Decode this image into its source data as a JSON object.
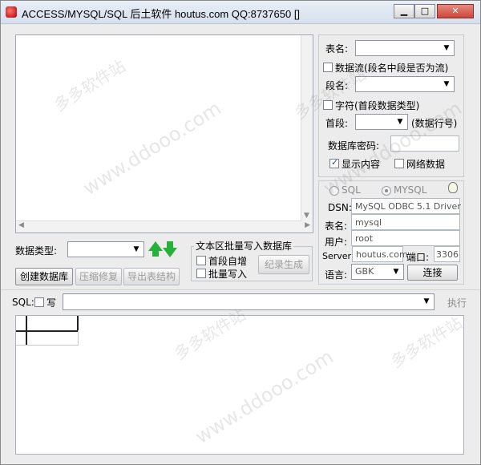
{
  "window": {
    "title": "ACCESS/MYSQL/SQL 后土软件 houtus.com QQ:8737650 []",
    "minimize_glyph": "▁",
    "maximize_glyph": "□",
    "close_glyph": "✕"
  },
  "right_panel": {
    "table_name_label": "表名:",
    "data_stream_label": "数据流(段名中段是否为流)",
    "field_name_label": "段名:",
    "char_label": "字符(首段数据类型)",
    "first_field_label": "首段:",
    "data_row_label": "(数据行号)",
    "db_password_label": "数据库密码:",
    "show_content_label": "显示内容",
    "network_data_label": "网络数据",
    "show_content_checked": true,
    "network_data_checked": false
  },
  "connection": {
    "sql_radio_label": "SQL",
    "mysql_radio_label": "MYSQL",
    "selected": "MYSQL",
    "dsn_label": "DSN:",
    "dsn_value": "MySQL ODBC 5.1 Driver",
    "table_label": "表名:",
    "table_value": "mysql",
    "user_label": "用户:",
    "user_value": "root",
    "server_label": "Server:",
    "server_value": "houtus.com",
    "port_label": "端口:",
    "port_value": "3306",
    "language_label": "语言:",
    "language_value": "GBK",
    "connect_button": "连接"
  },
  "middle": {
    "data_type_label": "数据类型:",
    "batch_group_title": "文本区批量写入数据库",
    "auto_increment_label": "首段自增",
    "batch_write_label": "批量写入",
    "record_generate_button": "纪录生成",
    "create_db_button": "创建数据库",
    "compress_repair_button": "压缩修复",
    "export_structure_button": "导出表结构"
  },
  "sql_bar": {
    "sql_label": "SQL:",
    "write_label": "写",
    "execute_button": "执行"
  },
  "watermarks": [
    "多多软件站",
    "www.ddooo.com"
  ]
}
